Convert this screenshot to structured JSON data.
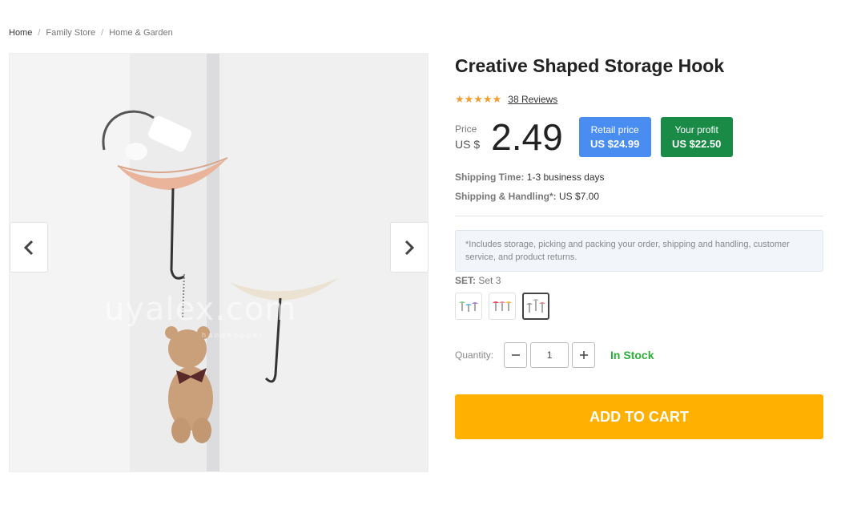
{
  "breadcrumb": [
    "Home",
    "Family Store",
    "Home & Garden"
  ],
  "gallery": {
    "watermark": "uyalex.com",
    "watermark_sub": "handhopper"
  },
  "product": {
    "title": "Creative Shaped Storage Hook",
    "rating": 4.5,
    "reviews_label": "38 Reviews",
    "price_label": "Price",
    "currency_label": "US $",
    "price": "2.49",
    "retail_label": "Retail price",
    "retail_value": "US $24.99",
    "profit_label": "Your profit",
    "profit_value": "US $22.50",
    "shipping_time_label": "Shipping Time:",
    "shipping_time_value": "1-3 business days",
    "shipping_handling_label": "Shipping & Handling*:",
    "shipping_handling_value": "US $7.00",
    "note": "*Includes storage, picking and packing your order, shipping and handling, customer service, and product returns.",
    "set_label": "SET:",
    "set_value": "Set 3",
    "quantity_label": "Quantity:",
    "quantity": "1",
    "stock": "In Stock",
    "add_to_cart": "ADD TO CART"
  },
  "colors": {
    "accent": "#ffb000",
    "retail": "#4a8df0",
    "profit": "#1a8a47",
    "stock": "#2ab13a"
  }
}
